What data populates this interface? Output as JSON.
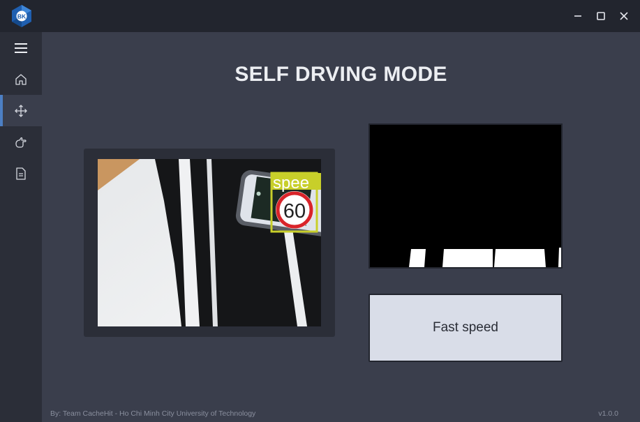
{
  "window": {
    "logo_text": "BK",
    "controls": [
      "minimize-icon",
      "maximize-icon",
      "close-icon"
    ]
  },
  "sidebar": {
    "items": [
      {
        "icon": "menu-icon",
        "active": false
      },
      {
        "icon": "home-icon",
        "active": false
      },
      {
        "icon": "move-icon",
        "active": true
      },
      {
        "icon": "hand-icon",
        "active": false
      },
      {
        "icon": "document-icon",
        "active": false
      }
    ],
    "accent_color": "#4c7fc4"
  },
  "main": {
    "title": "SELF DRVING MODE",
    "camera": {
      "detection_label": "spee",
      "sign_value": "60",
      "box_color": "#c8cf2a"
    },
    "speed_status": "Fast speed"
  },
  "footer": {
    "credit": "By: Team CacheHit - Ho Chi Minh City University of Technology",
    "version": "v1.0.0"
  }
}
